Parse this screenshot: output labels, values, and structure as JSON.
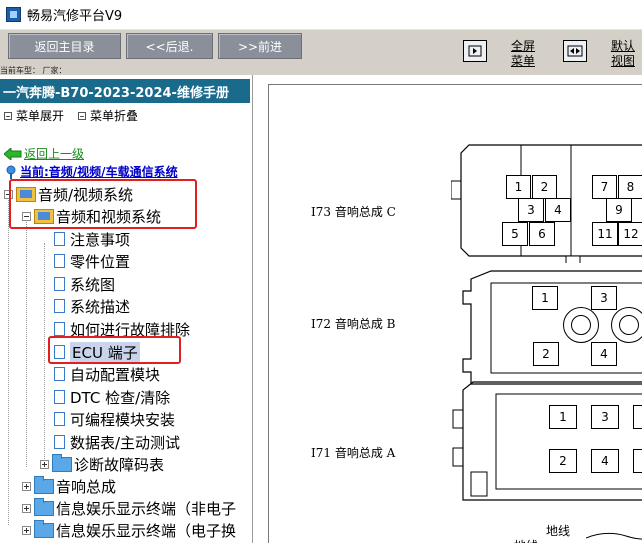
{
  "window": {
    "title": "畅易汽修平台V9"
  },
  "toolbar": {
    "back_main": "返回主目录",
    "back": "<<后退.",
    "forward": ">>前进",
    "fullscreen_line1": "全屏",
    "fullscreen_line2": "菜单",
    "default_view_line1": "默认",
    "default_view_line2": "视图",
    "vehicle_info": "当前车型：  厂家："
  },
  "left_panel": {
    "manual_title": "一汽奔腾-B70-2023-2024-维修手册",
    "expand_menu": "菜单展开",
    "collapse_menu": "菜单折叠",
    "back_link": "返回上一级",
    "current_path": "当前:音频/视频/车载通信系统",
    "tree": [
      {
        "label": "音频/视频系统"
      },
      {
        "label": "音频和视频系统"
      },
      {
        "label": "注意事项"
      },
      {
        "label": "零件位置"
      },
      {
        "label": "系统图"
      },
      {
        "label": "系统描述"
      },
      {
        "label": "如何进行故障排除"
      },
      {
        "label": "ECU 端子"
      },
      {
        "label": "自动配置模块"
      },
      {
        "label": "DTC 检查/清除"
      },
      {
        "label": "可编程模块安装"
      },
      {
        "label": "数据表/主动测试"
      },
      {
        "label": "诊断故障码表"
      },
      {
        "label": "音响总成"
      },
      {
        "label": "信息娱乐显示终端（非电子"
      },
      {
        "label": "信息娱乐显示终端（电子换"
      }
    ]
  },
  "diagram": {
    "connectors": [
      {
        "label": "I73 音响总成 C",
        "pins": [
          "1",
          "2",
          "3",
          "4",
          "5",
          "6",
          "7",
          "8",
          "9",
          "11",
          "12"
        ]
      },
      {
        "label": "I72 音响总成 B",
        "pins": [
          "1",
          "3",
          "2",
          "4"
        ]
      },
      {
        "label": "I71 音响总成 A",
        "pins": [
          "1",
          "3",
          "2",
          "4"
        ]
      }
    ],
    "ground_label": "地线",
    "ground_label_2": "地线"
  }
}
